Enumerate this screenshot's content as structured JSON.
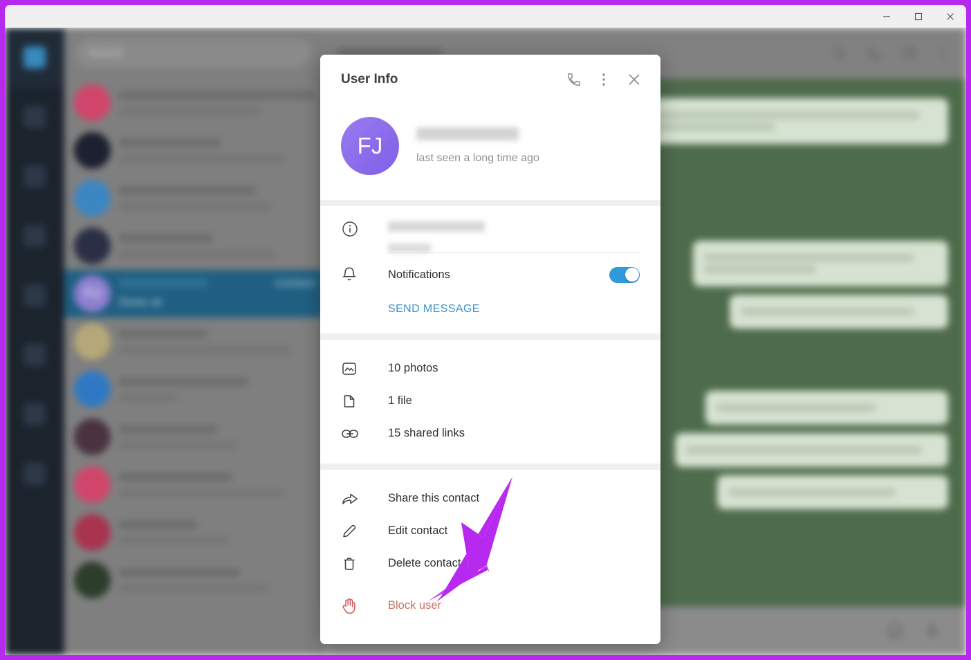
{
  "window": {
    "controls": [
      {
        "name": "minimize",
        "glyph": "minimize-icon"
      },
      {
        "name": "maximize",
        "glyph": "maximize-icon"
      },
      {
        "name": "close",
        "glyph": "close-icon"
      }
    ]
  },
  "sidebar": {
    "rail_items": [
      {
        "name": "chats",
        "active": true
      },
      {
        "name": "contacts",
        "active": false
      },
      {
        "name": "calls",
        "active": false
      },
      {
        "name": "stickers",
        "active": false
      },
      {
        "name": "settings",
        "active": false
      },
      {
        "name": "more-a",
        "active": false
      },
      {
        "name": "more-b",
        "active": false
      },
      {
        "name": "more-c",
        "active": false
      }
    ],
    "search": {
      "placeholder": "Search",
      "value": ""
    },
    "chats": [
      {
        "avatar_color": "#d1456b",
        "initials": "",
        "date": "",
        "preview": "",
        "selected": false
      },
      {
        "avatar_color": "#1c2030",
        "initials": "",
        "date": "",
        "preview": "",
        "selected": false
      },
      {
        "avatar_color": "#3c86c4",
        "initials": "",
        "date": "",
        "preview": "",
        "selected": false
      },
      {
        "avatar_color": "#2b2f45",
        "initials": "",
        "date": "",
        "preview": "",
        "selected": false
      },
      {
        "avatar_color": "#8e7fd0",
        "initials": "FJ",
        "date": "1/22/2023",
        "preview": "Done sir",
        "selected": true
      },
      {
        "avatar_color": "#b5a878",
        "initials": "",
        "date": "",
        "preview": "",
        "selected": false
      },
      {
        "avatar_color": "#2f79c4",
        "initials": "",
        "date": "",
        "preview": "",
        "selected": false
      },
      {
        "avatar_color": "#4a3340",
        "initials": "",
        "date": "",
        "preview": "",
        "selected": false
      },
      {
        "avatar_color": "#d1456b",
        "initials": "",
        "date": "",
        "preview": "",
        "selected": false
      },
      {
        "avatar_color": "#a8334f",
        "initials": "",
        "date": "",
        "preview": "",
        "selected": false
      },
      {
        "avatar_color": "#2d3d2b",
        "initials": "",
        "date": "",
        "preview": "",
        "selected": false
      }
    ]
  },
  "conversation": {
    "header_actions": [
      {
        "name": "search-icon"
      },
      {
        "name": "call-icon"
      },
      {
        "name": "info-panel-icon"
      },
      {
        "name": "more-vertical-icon"
      }
    ],
    "composer_actions": [
      {
        "name": "emoji-icon"
      },
      {
        "name": "microphone-icon"
      }
    ]
  },
  "dialog": {
    "title": "User Info",
    "header_actions": [
      {
        "name": "call-icon"
      },
      {
        "name": "more-vertical-icon"
      },
      {
        "name": "close-icon"
      }
    ],
    "profile": {
      "initials": "FJ",
      "status": "last seen a long time ago"
    },
    "notifications": {
      "label": "Notifications",
      "enabled": true,
      "toggle_color": "#2f9bdb"
    },
    "send_message_label": "SEND MESSAGE",
    "link_color": "#3d90cc",
    "media": [
      {
        "icon": "photos-icon",
        "label": "10 photos"
      },
      {
        "icon": "file-icon",
        "label": "1 file"
      },
      {
        "icon": "link-icon",
        "label": "15 shared links"
      }
    ],
    "actions": [
      {
        "icon": "share-icon",
        "label": "Share this contact",
        "danger": false
      },
      {
        "icon": "edit-pencil-icon",
        "label": "Edit contact",
        "danger": false
      },
      {
        "icon": "trash-icon",
        "label": "Delete contact",
        "danger": false
      },
      {
        "icon": "block-hand-icon",
        "label": "Block user",
        "danger": true
      }
    ],
    "danger_color": "#c9705f"
  },
  "annotation": {
    "arrow_color": "#b829f0",
    "points_to": "Block user"
  }
}
